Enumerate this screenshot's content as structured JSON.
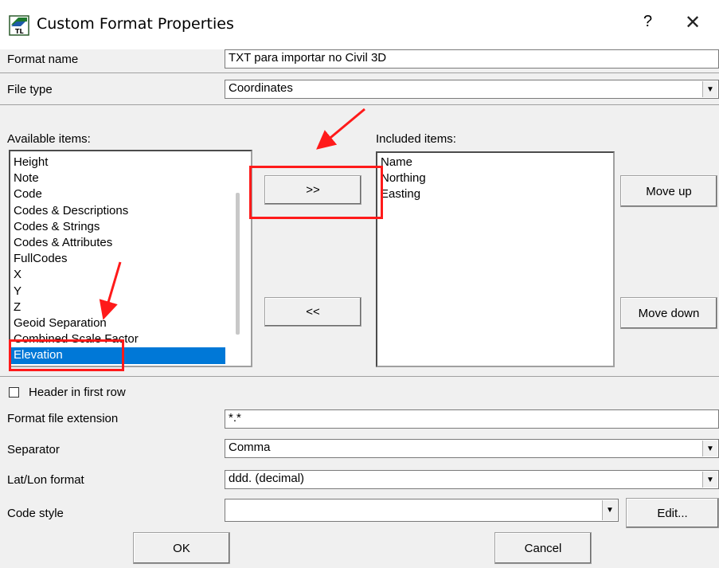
{
  "window": {
    "title": "Custom Format Properties",
    "help_label": "?",
    "close_label": "✕"
  },
  "format_name": {
    "label": "Format name",
    "value": "TXT para importar no Civil 3D"
  },
  "file_type": {
    "label": "File type",
    "value": "Coordinates"
  },
  "available": {
    "label": "Available items:",
    "items": [
      "Height",
      "Note",
      "Code",
      "Codes & Descriptions",
      "Codes & Strings",
      "Codes & Attributes",
      "FullCodes",
      "X",
      "Y",
      "Z",
      "Geoid Separation",
      "Combined Scale Factor",
      "Elevation"
    ],
    "selected": "Elevation"
  },
  "included": {
    "label": "Included items:",
    "items": [
      "Name",
      "Northing",
      "Easting"
    ]
  },
  "buttons": {
    "add": ">>",
    "remove": "<<",
    "move_up": "Move up",
    "move_down": "Move down",
    "edit": "Edit...",
    "ok": "OK",
    "cancel": "Cancel"
  },
  "header_first_row": {
    "label": "Header in first row",
    "checked": false
  },
  "extension": {
    "label": "Format file extension",
    "value": "*.*"
  },
  "separator": {
    "label": "Separator",
    "value": "Comma"
  },
  "latlon": {
    "label": "Lat/Lon format",
    "value": "ddd. (decimal)"
  },
  "code_style": {
    "label": "Code style",
    "value": ""
  },
  "annotation_color": "#ff1a1a",
  "selection_color": "#0078d7"
}
